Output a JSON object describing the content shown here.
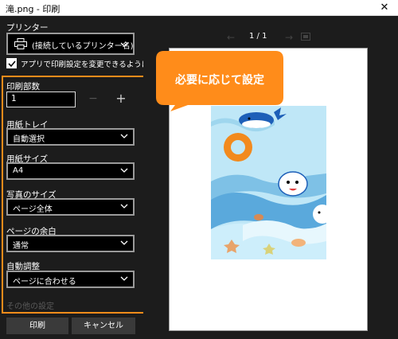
{
  "window": {
    "title": "滝.png - 印刷",
    "close_glyph": "✕"
  },
  "printer": {
    "label": "プリンター",
    "selected": "(接続しているプリンター名)"
  },
  "allow_app_settings": {
    "label": "アプリで印刷設定を変更できるようにする",
    "checked": true
  },
  "copies": {
    "label": "印刷部数",
    "value": "1",
    "minus": "−",
    "plus": "+"
  },
  "paper_tray": {
    "label": "用紙トレイ",
    "value": "自動選択"
  },
  "paper_size": {
    "label": "用紙サイズ",
    "value": "A4"
  },
  "photo_size": {
    "label": "写真のサイズ",
    "value": "ページ全体"
  },
  "page_margins": {
    "label": "ページの余白",
    "value": "通常"
  },
  "auto_adjust": {
    "label": "自動調整",
    "value": "ページに合わせる"
  },
  "more_settings": "その他の設定",
  "buttons": {
    "print": "印刷",
    "cancel": "キャンセル"
  },
  "preview": {
    "prev": "←",
    "page_counter": "1 / 1",
    "next": "→"
  },
  "annotation": {
    "text": "必要に応じて設定",
    "color": "#ff8c1a"
  },
  "colors": {
    "accent_orange": "#ff8c1a",
    "panel_bg": "#1c1c1c",
    "sky_blue": "#bfe7f7",
    "ring_orange": "#f28a1e"
  }
}
